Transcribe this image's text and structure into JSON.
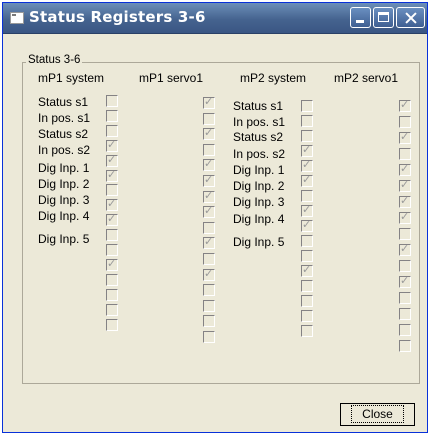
{
  "window": {
    "title": "Status Registers 3-6"
  },
  "group": {
    "label": "Status 3-6"
  },
  "columns": {
    "mp1_system": "mP1 system",
    "mp1_servo1": "mP1 servo1",
    "mp2_system": "mP2 system",
    "mp2_servo1": "mP2 servo1"
  },
  "labels": {
    "mp1": [
      "Status s1",
      "In pos. s1",
      "Status s2",
      "In pos. s2",
      "Dig Inp. 1",
      "Dig Inp. 2",
      "Dig Inp. 3",
      "Dig Inp. 4",
      "Dig Inp. 5"
    ],
    "mp2": [
      "Status s1",
      "In pos. s1",
      "Status s2",
      "In pos. s2",
      "Dig Inp. 1",
      "Dig Inp. 2",
      "Dig Inp. 3",
      "Dig Inp. 4",
      "Dig Inp. 5"
    ]
  },
  "checkboxes": {
    "mp1_system": [
      false,
      false,
      false,
      true,
      true,
      true,
      false,
      true,
      true,
      false,
      false,
      true,
      false,
      false,
      false,
      false
    ],
    "mp1_servo1": [
      true,
      false,
      true,
      false,
      true,
      true,
      true,
      true,
      false,
      true,
      false,
      true,
      false,
      false,
      false,
      false
    ],
    "mp2_system": [
      false,
      false,
      false,
      true,
      true,
      true,
      false,
      true,
      true,
      false,
      false,
      true,
      false,
      false,
      false,
      false
    ],
    "mp2_servo1": [
      true,
      false,
      true,
      false,
      true,
      true,
      true,
      true,
      false,
      true,
      false,
      true,
      false,
      false,
      false,
      false
    ]
  },
  "buttons": {
    "close": "Close"
  }
}
